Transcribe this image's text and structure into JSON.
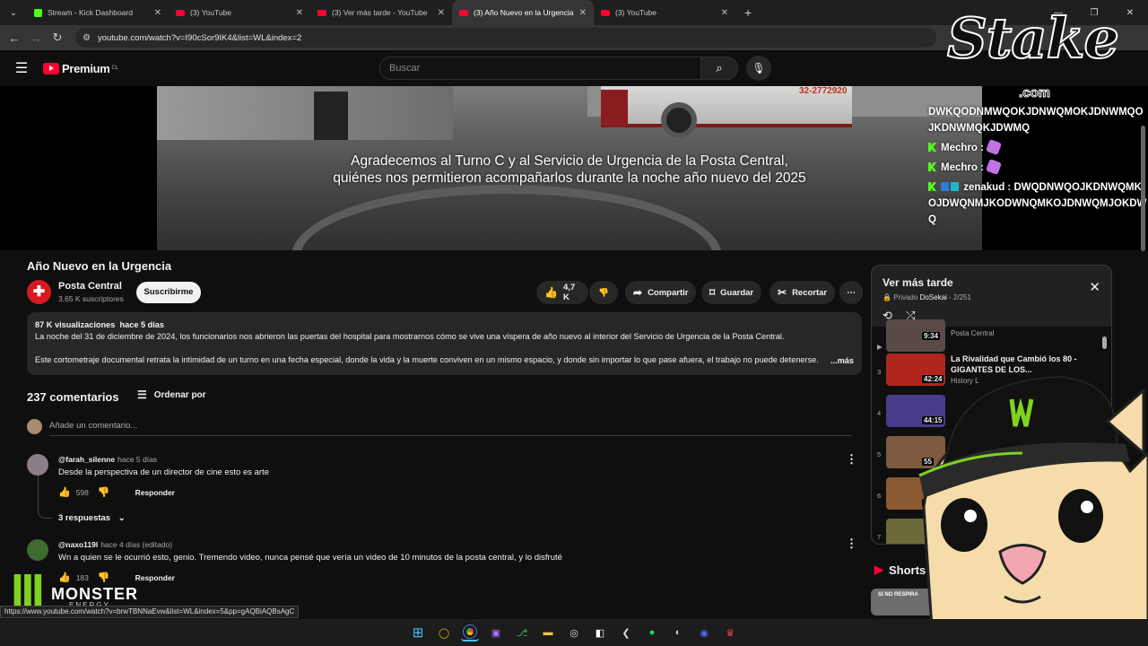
{
  "browser": {
    "tabs": [
      {
        "title": "Stream - Kick Dashboard",
        "kind": "kick"
      },
      {
        "title": "(3) YouTube",
        "kind": "yt"
      },
      {
        "title": "(3) Ver más tarde - YouTube",
        "kind": "yt"
      },
      {
        "title": "(3) Año Nuevo en la Urgencia -",
        "kind": "yt",
        "active": true
      },
      {
        "title": "(3) YouTube",
        "kind": "yt"
      }
    ],
    "url": "youtube.com/watch?v=I90cSor9IK4&list=WL&index=2"
  },
  "youtube": {
    "logo": "Premium",
    "region": "CL",
    "search_placeholder": "Buscar"
  },
  "video": {
    "caption_1": "Agradecemos al Turno C y al Servicio de Urgencia de la Posta Central,",
    "caption_2": "quiénes nos permitieron acompañarlos durante la noche año nuevo del 2025",
    "van_text": "32-2772920",
    "title": "Año Nuevo en la Urgencia"
  },
  "channel": {
    "name": "Posta Central",
    "subscribers": "3,65 K suscriptores",
    "subscribe_label": "Suscribirme"
  },
  "actions": {
    "likes": "4,7 K",
    "share": "Compartir",
    "save": "Guardar",
    "clip": "Recortar"
  },
  "description": {
    "views": "87 K visualizaciones",
    "age": "hace 5 días",
    "line1": "La noche del 31 de diciembre de 2024, los funcionarios nos abrieron las puertas del hospital para mostrarnos cómo se vive una víspera de año nuevo al interior del Servicio de Urgencia de la Posta Central.",
    "line2": "Este cortometraje documental retrata la intimidad de un turno en una fecha especial,  donde la vida y la muerte conviven en un mismo espacio, y donde sin importar lo que pase afuera, el trabajo no puede detenerse.",
    "more": "...más"
  },
  "comments_section": {
    "count": "237 comentarios",
    "sort": "Ordenar por",
    "add_placeholder": "Añade un comentario...",
    "comments": [
      {
        "user": "@farah_silenne",
        "age": "hace 5 días",
        "text": "Desde la perspectiva de un director de cine esto es arte",
        "likes": "598",
        "reply": "Responder",
        "replies": "3 respuestas"
      },
      {
        "user": "@naxo119l",
        "age": "hace 4 días (editado)",
        "text": "Wn a quien se le ocurrió esto, genio. Tremendo video, nunca pensé que vería un video de 10 minutos de la posta central, y lo disfruté",
        "likes": "183",
        "reply": "Responder"
      }
    ]
  },
  "playlist": {
    "title": "Ver más tarde",
    "privacy": "Privado",
    "owner": "DoSekai",
    "position": "2/251",
    "items": [
      {
        "num": "▶",
        "duration": "9:34",
        "title": "",
        "channel": "Posta Central",
        "color": "#5a4a46"
      },
      {
        "num": "3",
        "duration": "42:24",
        "title": "La Rivalidad que Cambió los 80 - GIGANTES DE LOS...",
        "channel": "History L",
        "color": "#b0261c"
      },
      {
        "num": "4",
        "duration": "44:15",
        "title": "",
        "channel": "",
        "color": "#4b3b8c"
      },
      {
        "num": "5",
        "duration": "55",
        "title": "",
        "channel": "",
        "color": "#7d5a40"
      },
      {
        "num": "6",
        "duration": "4",
        "title": "",
        "channel": "",
        "color": "#8c5a32"
      },
      {
        "num": "7",
        "duration": "",
        "title": "",
        "channel": "",
        "color": "#6b6b3a"
      }
    ]
  },
  "shorts": {
    "label": "Shorts",
    "thumb_text": "SI NO RESPIRA"
  },
  "overlay": {
    "stake": "Stake",
    "stake_com": ".com",
    "chat": [
      {
        "user": "",
        "text": "DWKQODNMWQOKJDNWQMOKJDNWMQOJKDNWMQKJDWMQ"
      },
      {
        "user": "Mechro",
        "text": ":"
      },
      {
        "user": "Mechro",
        "text": ":"
      },
      {
        "user": "zenakud",
        "text": ": DWQDNWQOJKDNWQMKOJDWQNMJKODWNQMKOJDNWQMJOKDWQ"
      }
    ],
    "monster": "MONSTER",
    "monster_sub": "ENERGY"
  },
  "status_url": "https://www.youtube.com/watch?v=brwTBNNaEvw&list=WL&index=5&pp=gAQBiAQBsAgC",
  "taskbar": [
    "windows",
    "overwolf",
    "chrome",
    "twitch",
    "sourcetree",
    "folder",
    "obs",
    "capcut",
    "git",
    "spotify",
    "steam",
    "discord",
    "app"
  ]
}
